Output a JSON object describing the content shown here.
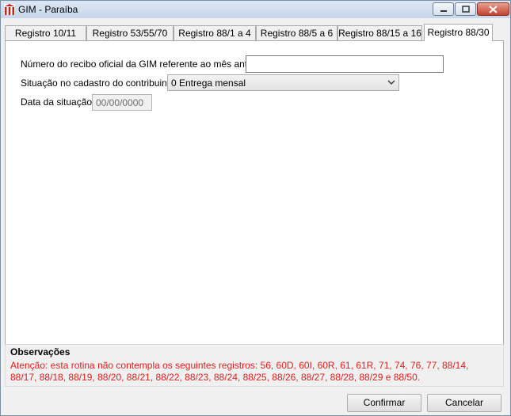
{
  "window": {
    "title": "GIM - Paraíba",
    "icon": "gim-app-icon"
  },
  "tabs": [
    {
      "label": "Registro 10/11",
      "active": false
    },
    {
      "label": "Registro 53/55/70",
      "active": false
    },
    {
      "label": "Registro 88/1 a 4",
      "active": false
    },
    {
      "label": "Registro 88/5 a 6",
      "active": false
    },
    {
      "label": "Registro 88/15 a 16",
      "active": false
    },
    {
      "label": "Registro 88/30",
      "active": true
    }
  ],
  "form": {
    "recibo_label": "Número do recibo oficial da GIM referente ao mês anterior",
    "recibo_value": "",
    "situacao_label": "Situação no cadastro do contribuinte",
    "situacao_value": "0 Entrega mensal",
    "data_label": "Data da situação",
    "data_value": "00/00/0000"
  },
  "observacoes": {
    "title": "Observações",
    "text": "Atenção: esta rotina não contempla os seguintes registros: 56, 60D, 60I, 60R, 61, 61R, 71, 74, 76, 77, 88/14, 88/17, 88/18, 88/19, 88/20, 88/21, 88/22, 88/23, 88/24, 88/25, 88/26, 88/27, 88/28, 88/29 e 88/50.",
    "text_color": "#e11c1c"
  },
  "buttons": {
    "confirm": "Confirmar",
    "cancel": "Cancelar"
  }
}
